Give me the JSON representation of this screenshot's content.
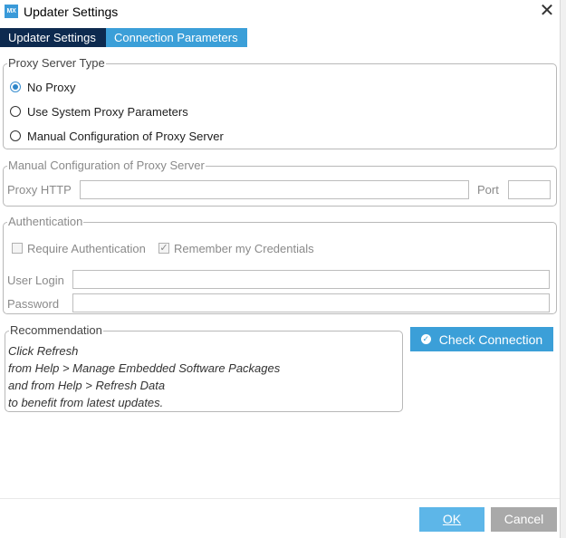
{
  "window": {
    "app_icon": "MX",
    "title": "Updater Settings",
    "close_icon": "✕"
  },
  "tabs": [
    {
      "label": "Updater Settings",
      "active": false
    },
    {
      "label": "Connection Parameters",
      "active": true
    }
  ],
  "proxy_type": {
    "legend": "Proxy Server Type",
    "options": [
      {
        "label": "No Proxy",
        "selected": true
      },
      {
        "label": "Use System Proxy Parameters",
        "selected": false
      },
      {
        "label": "Manual Configuration of Proxy Server",
        "selected": false
      }
    ]
  },
  "manual_config": {
    "legend": "Manual Configuration of Proxy Server",
    "proxy_http_label": "Proxy HTTP",
    "proxy_http_value": "",
    "port_label": "Port",
    "port_value": ""
  },
  "authentication": {
    "legend": "Authentication",
    "require_auth_label": "Require Authentication",
    "require_auth_checked": false,
    "remember_label": "Remember my Credentials",
    "remember_checked": true,
    "user_login_label": "User Login",
    "user_login_value": "",
    "password_label": "Password",
    "password_value": ""
  },
  "recommendation": {
    "legend": "Recommendation",
    "lines": [
      "Click Refresh",
      "from Help > Manage Embedded Software Packages",
      "and from Help > Refresh Data",
      "to benefit from latest updates."
    ]
  },
  "buttons": {
    "check_connection": "Check Connection",
    "ok": "OK",
    "cancel": "Cancel"
  },
  "colors": {
    "tab_inactive": "#0d2a4f",
    "tab_active": "#3b9fd8",
    "ok_button": "#5db6e8",
    "cancel_button": "#a9a9a9"
  }
}
